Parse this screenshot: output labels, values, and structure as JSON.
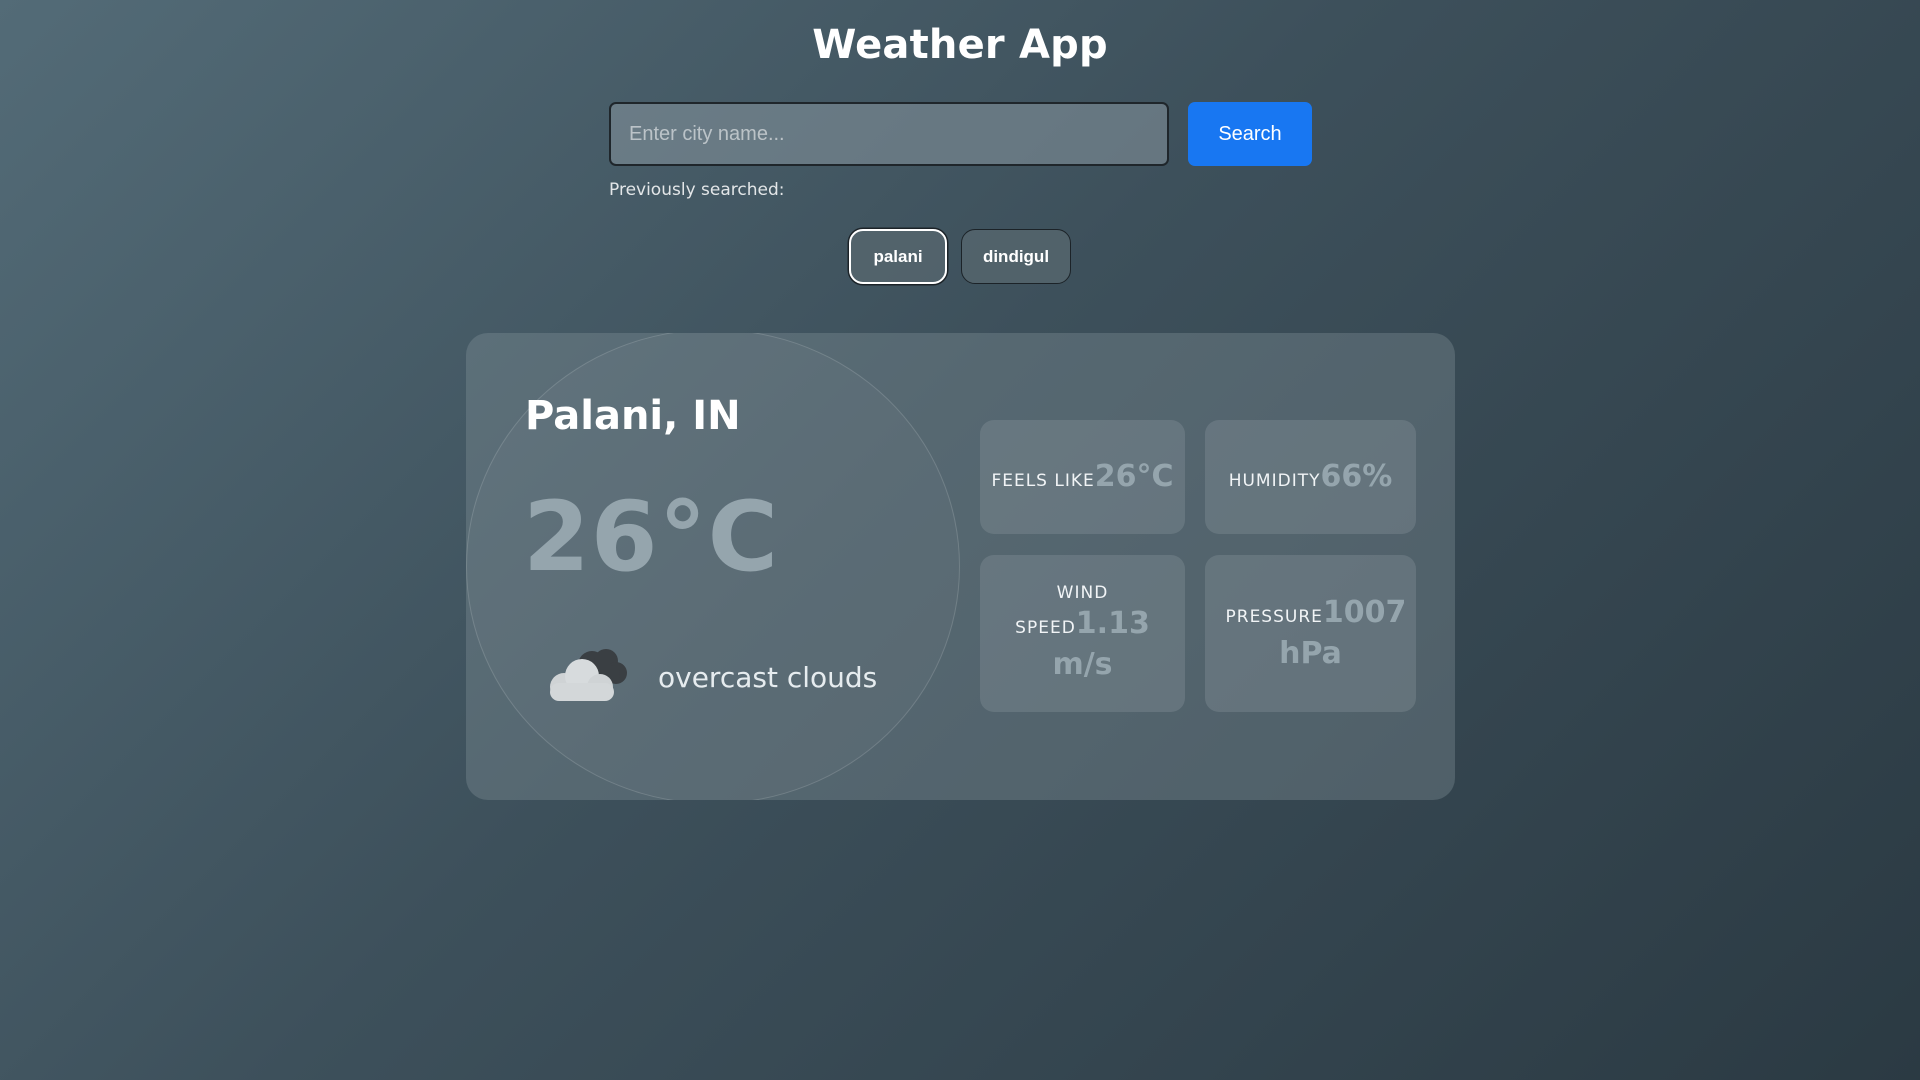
{
  "app": {
    "title": "Weather App"
  },
  "search": {
    "placeholder": "Enter city name...",
    "value": "",
    "button_label": "Search"
  },
  "history": {
    "label": "Previously searched:",
    "items": [
      {
        "label": "palani",
        "active": true
      },
      {
        "label": "dindigul",
        "active": false
      }
    ]
  },
  "weather": {
    "location": "Palani, IN",
    "temperature": "26°C",
    "condition_icon": "overcast-clouds-icon",
    "description": "overcast clouds",
    "stats": {
      "feels_like": {
        "label": "Feels like",
        "value": "26°C"
      },
      "humidity": {
        "label": "Humidity",
        "value": "66%"
      },
      "wind_speed": {
        "label": "Wind speed",
        "value": "1.13 m/s"
      },
      "pressure": {
        "label": "Pressure",
        "value": "1007 hPa"
      }
    }
  },
  "colors": {
    "accent": "#1877f2",
    "muted_value": "#95a5ad",
    "background_start": "#536b77",
    "background_end": "#2b3a43"
  }
}
